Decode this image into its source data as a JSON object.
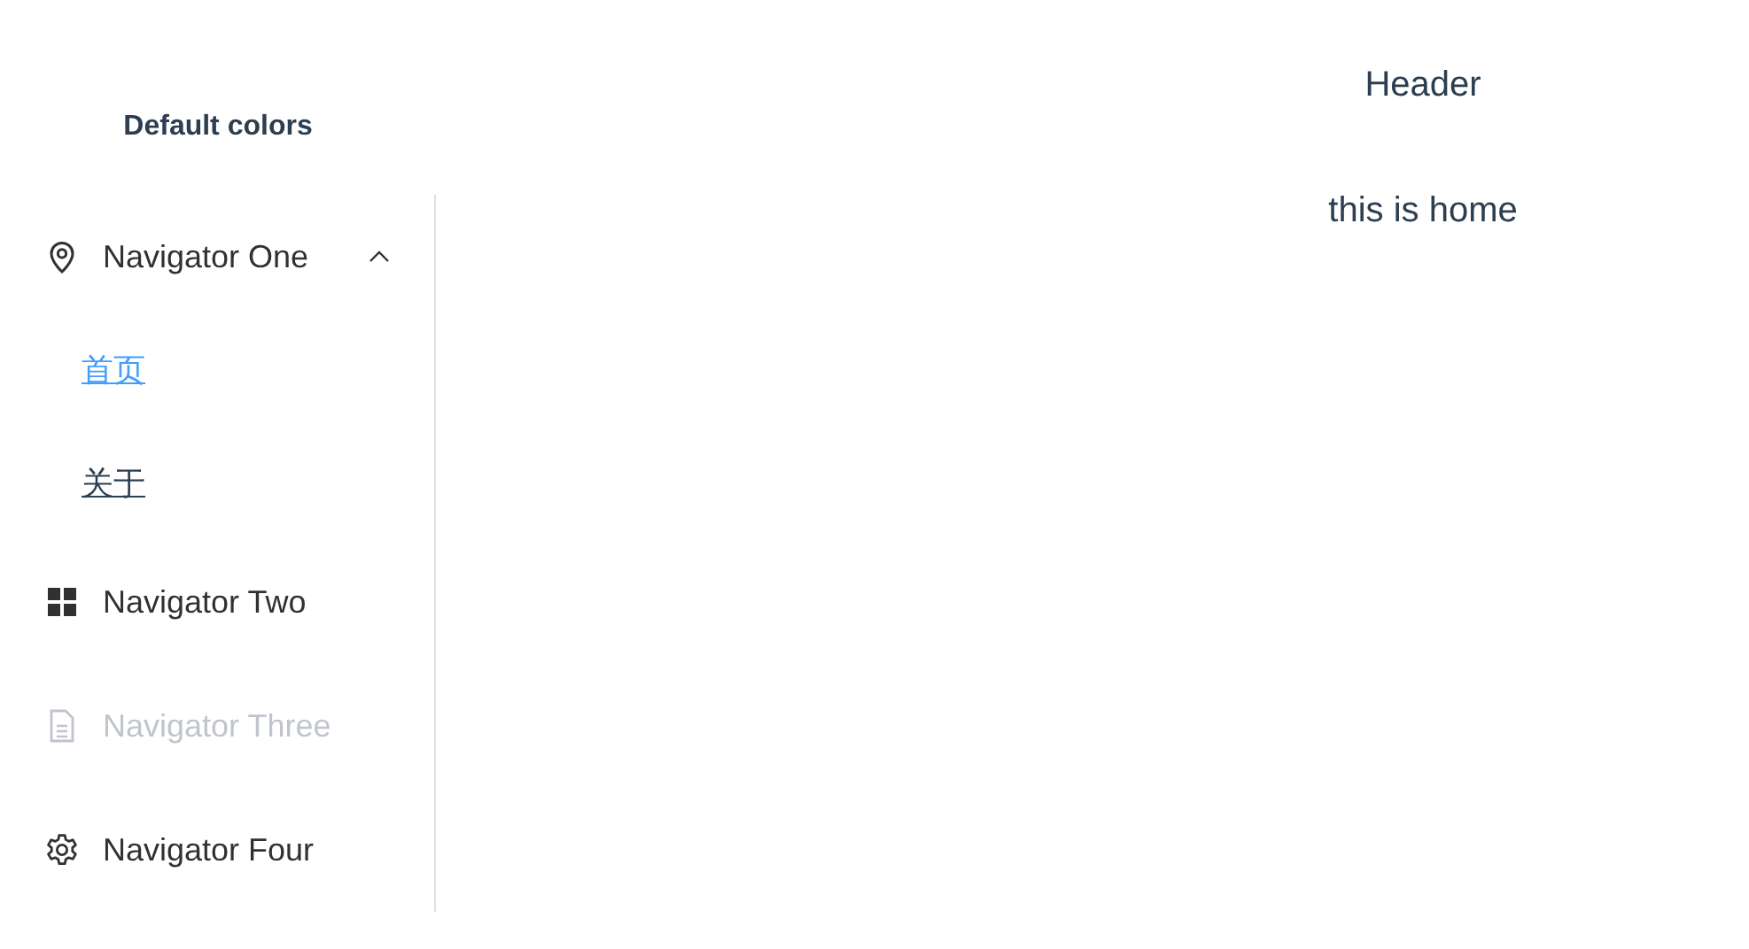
{
  "sidebar": {
    "title": "Default colors",
    "menu": [
      {
        "label": "Navigator One",
        "kind": "submenu",
        "expanded": true,
        "disabled": false,
        "children": [
          {
            "label": "首页",
            "selected": true
          },
          {
            "label": "关于",
            "selected": false
          }
        ]
      },
      {
        "label": "Navigator Two",
        "kind": "item",
        "disabled": false
      },
      {
        "label": "Navigator Three",
        "kind": "item",
        "disabled": true
      },
      {
        "label": "Navigator Four",
        "kind": "item",
        "disabled": false
      }
    ]
  },
  "header": {
    "title": "Header"
  },
  "content": {
    "text": "this is home"
  }
}
